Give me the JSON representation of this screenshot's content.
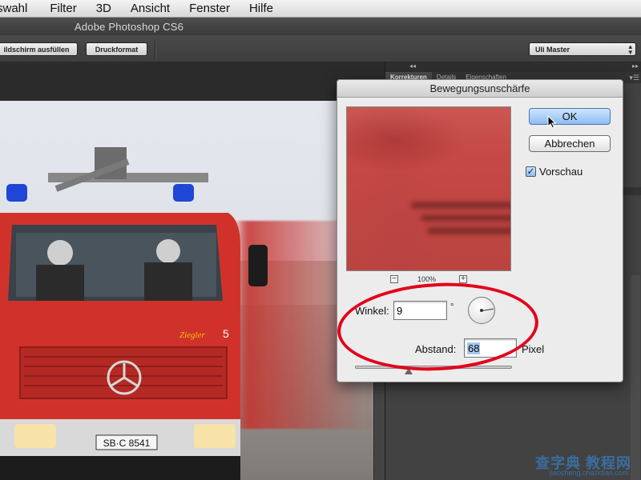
{
  "menubar": {
    "items": [
      "swahl",
      "Filter",
      "3D",
      "Ansicht",
      "Fenster",
      "Hilfe"
    ]
  },
  "titlebar": {
    "title": "Adobe Photoshop CS6"
  },
  "options": {
    "fill_screen": "ildschirm ausfüllen",
    "print_format": "Druckformat",
    "workspace": "Uli Master"
  },
  "panels": {
    "tabs": [
      "Korrekturen",
      "Details",
      "Eigenschaften"
    ]
  },
  "document": {
    "license_plate": "SB·C 8541",
    "unit_number": "5",
    "brand_text": "Ziegler"
  },
  "dialog": {
    "title": "Bewegungsunschärfe",
    "ok_label": "OK",
    "cancel_label": "Abbrechen",
    "preview_label": "Vorschau",
    "preview_checked": true,
    "zoom_value": "100%",
    "angle_label": "Winkel:",
    "angle_value": "9",
    "angle_unit": "°",
    "distance_label": "Abstand:",
    "distance_value": "68",
    "distance_unit": "Pixel",
    "distance_slider": 0.34
  },
  "annotation_color": "#e3001b",
  "watermark": {
    "line1": "查字典 教程网",
    "line2": "jiaocheng.chazidian.com"
  }
}
